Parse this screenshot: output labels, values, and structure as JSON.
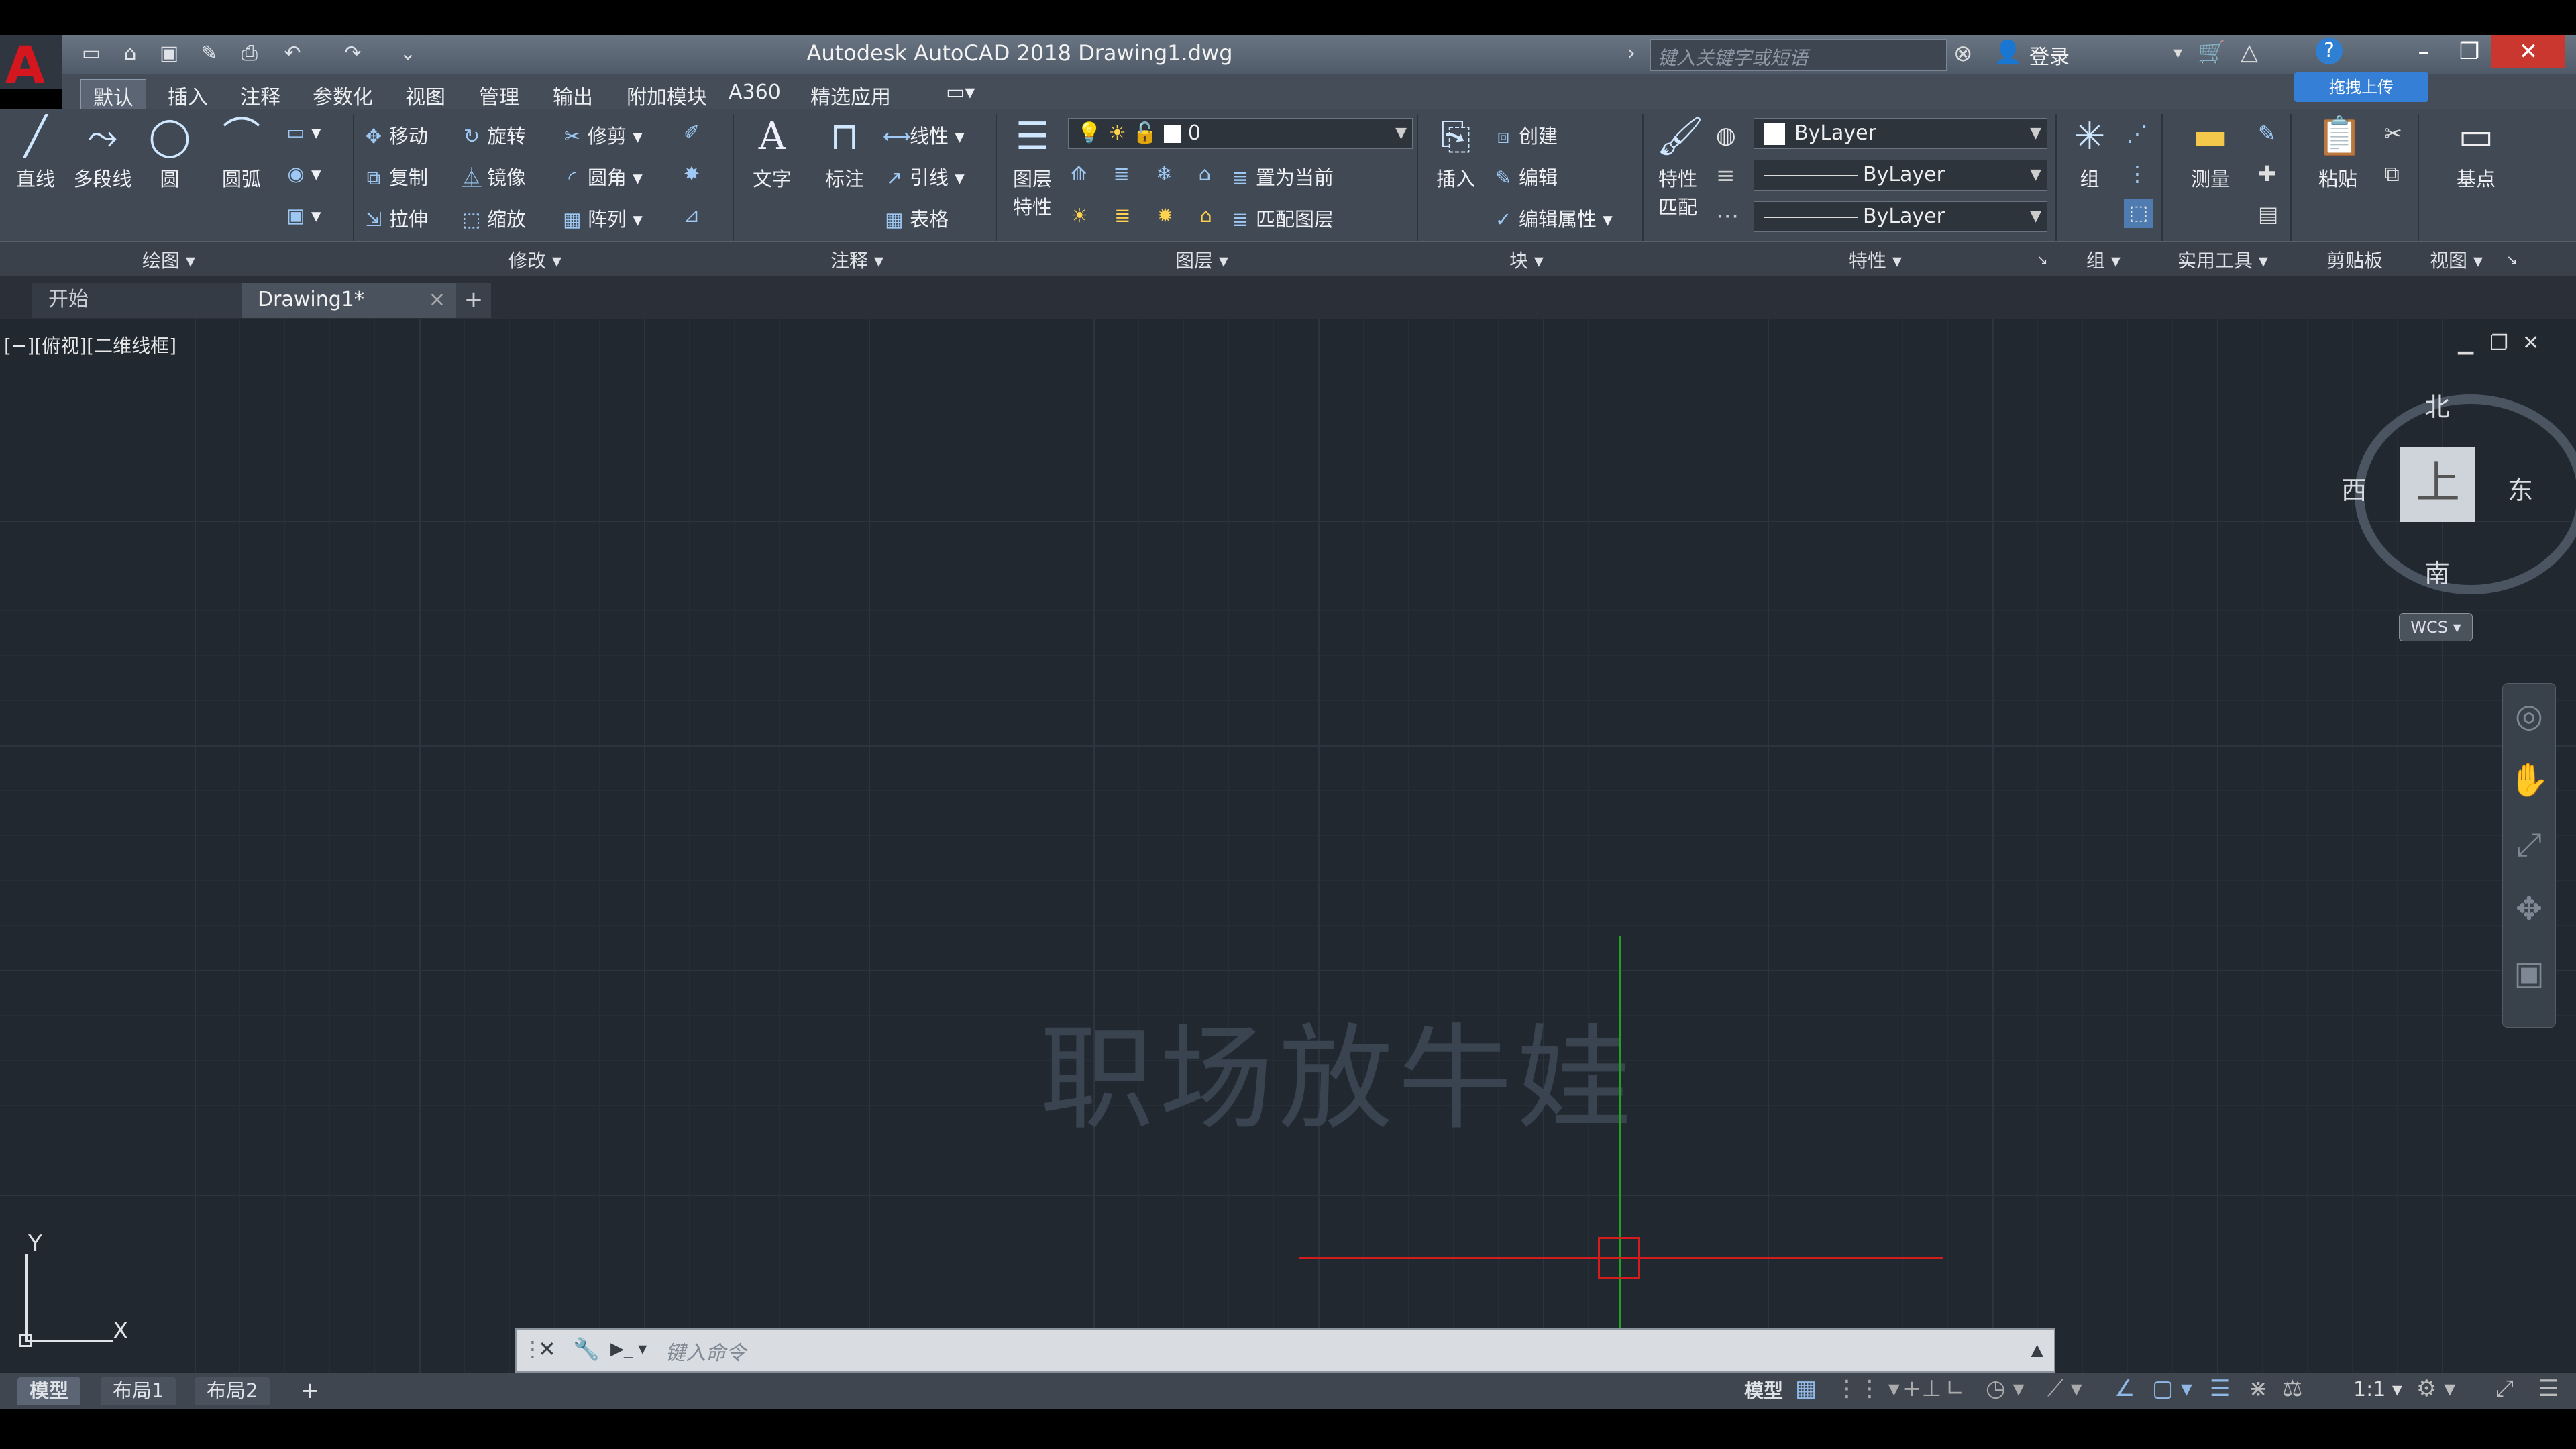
{
  "titlebar": {
    "title": "Autodesk AutoCAD 2018    Drawing1.dwg",
    "search_placeholder": "键入关键字或短语",
    "login_label": "登录",
    "app_letter": "A"
  },
  "menu_tabs": [
    "默认",
    "插入",
    "注释",
    "参数化",
    "视图",
    "管理",
    "输出",
    "附加模块",
    "A360",
    "精选应用"
  ],
  "upload_label": "拖拽上传",
  "ribbon": {
    "draw": {
      "line": "直线",
      "polyline": "多段线",
      "circle": "圆",
      "arc": "圆弧",
      "panel": "绘图"
    },
    "modify": {
      "move": "移动",
      "rotate": "旋转",
      "trim": "修剪",
      "copy": "复制",
      "mirror": "镜像",
      "fillet": "圆角",
      "stretch": "拉伸",
      "scale": "缩放",
      "array": "阵列",
      "panel": "修改"
    },
    "annotation": {
      "text": "文字",
      "dimension": "标注",
      "linear": "线性",
      "leader": "引线",
      "table": "表格",
      "panel": "注释"
    },
    "layers": {
      "layer_props": "图层\n特性",
      "layer_props_1": "图层",
      "layer_props_2": "特性",
      "current_layer": "0",
      "set_current": "置为当前",
      "match_layer": "匹配图层",
      "panel": "图层"
    },
    "block": {
      "insert": "插入",
      "create": "创建",
      "edit": "编辑",
      "edit_attrs": "编辑属性",
      "panel": "块"
    },
    "properties": {
      "match_1": "特性",
      "match_2": "匹配",
      "color": "ByLayer",
      "linetype": "ByLayer",
      "lineweight": "ByLayer",
      "panel": "特性"
    },
    "groups": {
      "group": "组",
      "panel": "组"
    },
    "utilities": {
      "measure": "测量",
      "panel": "实用工具"
    },
    "clipboard": {
      "paste": "粘贴",
      "panel": "剪贴板"
    },
    "view": {
      "basepoint": "基点",
      "panel": "视图"
    }
  },
  "doc_tabs": {
    "start": "开始",
    "drawing": "Drawing1*",
    "add": "+"
  },
  "viewport": {
    "label": "[−][俯视][二维线框]",
    "watermark": "职场放牛娃",
    "viewcube": {
      "top": "上",
      "north": "北",
      "south": "南",
      "east": "东",
      "west": "西",
      "wcs": "WCS"
    },
    "ucs": {
      "x": "X",
      "y": "Y"
    }
  },
  "command_line": {
    "placeholder": "键入命令"
  },
  "status": {
    "layout_tabs": [
      "模型",
      "布局1",
      "布局2"
    ],
    "model_label": "模型",
    "scale": "1:1"
  },
  "colors": {
    "cross_x": "#d31c1c",
    "cross_y": "#1fa31f",
    "canvas": "#212830"
  }
}
